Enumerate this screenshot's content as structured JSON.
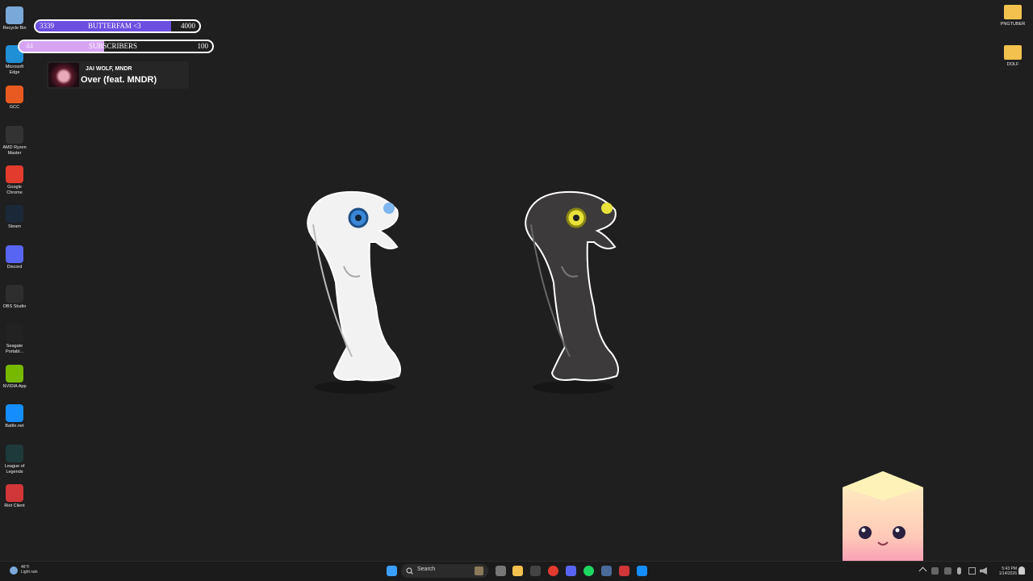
{
  "desktop_icons": [
    {
      "label": "Recycle Bin",
      "icon": "recycle-bin-icon",
      "color": "#7aa8d8"
    },
    {
      "label": "Microsoft Edge",
      "icon": "edge-icon",
      "color": "#1f8fd6"
    },
    {
      "label": "GCC",
      "icon": "gcc-icon",
      "color": "#e85a20"
    },
    {
      "label": "AMD Ryzen Master",
      "icon": "ryzen-icon",
      "color": "#333333"
    },
    {
      "label": "Google Chrome",
      "icon": "chrome-icon",
      "color": "#e33b2e"
    },
    {
      "label": "Steam",
      "icon": "steam-icon",
      "color": "#1b2838"
    },
    {
      "label": "Discord",
      "icon": "discord-icon",
      "color": "#5865f2"
    },
    {
      "label": "OBS Studio",
      "icon": "obs-icon",
      "color": "#2e2e2e"
    },
    {
      "label": "Seagate Portabl...",
      "icon": "seagate-icon",
      "color": "#222222"
    },
    {
      "label": "NVIDIA App",
      "icon": "nvidia-icon",
      "color": "#76b900"
    },
    {
      "label": "Battle.net",
      "icon": "battlenet-icon",
      "color": "#148eff"
    },
    {
      "label": "League of Legends",
      "icon": "league-icon",
      "color": "#1e3a3a"
    },
    {
      "label": "Riot Client",
      "icon": "riot-icon",
      "color": "#d13639"
    }
  ],
  "right_icons": [
    {
      "label": "PNGTUBER",
      "icon": "folder-icon"
    },
    {
      "label": "DOLF",
      "icon": "folder-icon"
    }
  ],
  "goal_bars": [
    {
      "current": "3339",
      "label": "BUTTERFAM <3",
      "target": "4000",
      "progress": 0.83,
      "color": "#6c4fe0"
    },
    {
      "current": "44",
      "label": "SUBSCRIBERS",
      "target": "100",
      "progress": 0.44,
      "color": "#d7a4f2"
    }
  ],
  "now_playing": {
    "artist": "JAI WOLF, MNDR",
    "track": "Over (feat. MNDR)"
  },
  "taskbar": {
    "search_placeholder": "Search",
    "weather_temp": "46°F",
    "weather_desc": "Light rain",
    "time": "5:43 PM",
    "date": "1/14/2026"
  }
}
